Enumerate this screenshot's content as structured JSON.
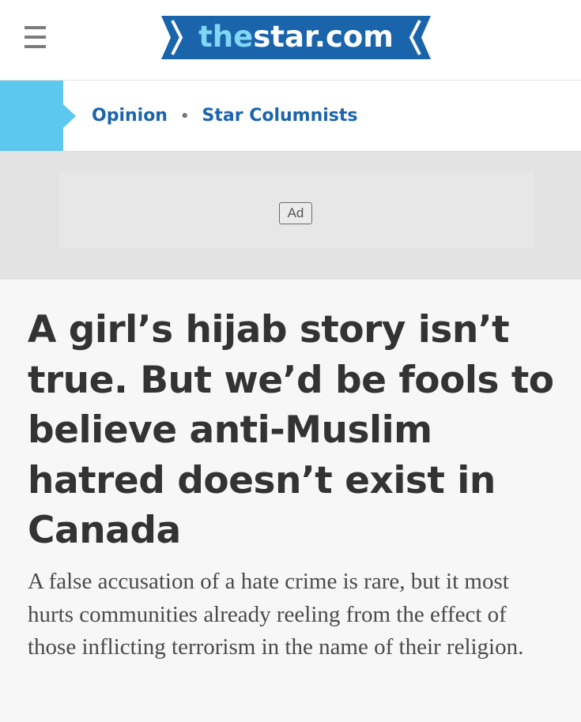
{
  "header": {
    "menu_icon": "hamburger-menu-icon",
    "logo": {
      "prefix": "the",
      "main": "star.com",
      "colors": {
        "ribbon": "#1a64ac",
        "prefix": "#7fd6f5",
        "main": "#ffffff"
      }
    }
  },
  "nav": {
    "flag_color": "#5cc8ef",
    "breadcrumb": [
      {
        "label": "Opinion"
      },
      {
        "label": "Star Columnists"
      }
    ],
    "separator": "•"
  },
  "ad": {
    "label": "Ad"
  },
  "article": {
    "headline": "A girl’s hijab story isn’t true. But we’d be fools to believe anti-Muslim hatred doesn’t exist in Canada",
    "subhead": "A false accusation of a hate crime is rare, but it most hurts communities already reeling from the effect of those inflicting terrorism in the name of their religion."
  }
}
